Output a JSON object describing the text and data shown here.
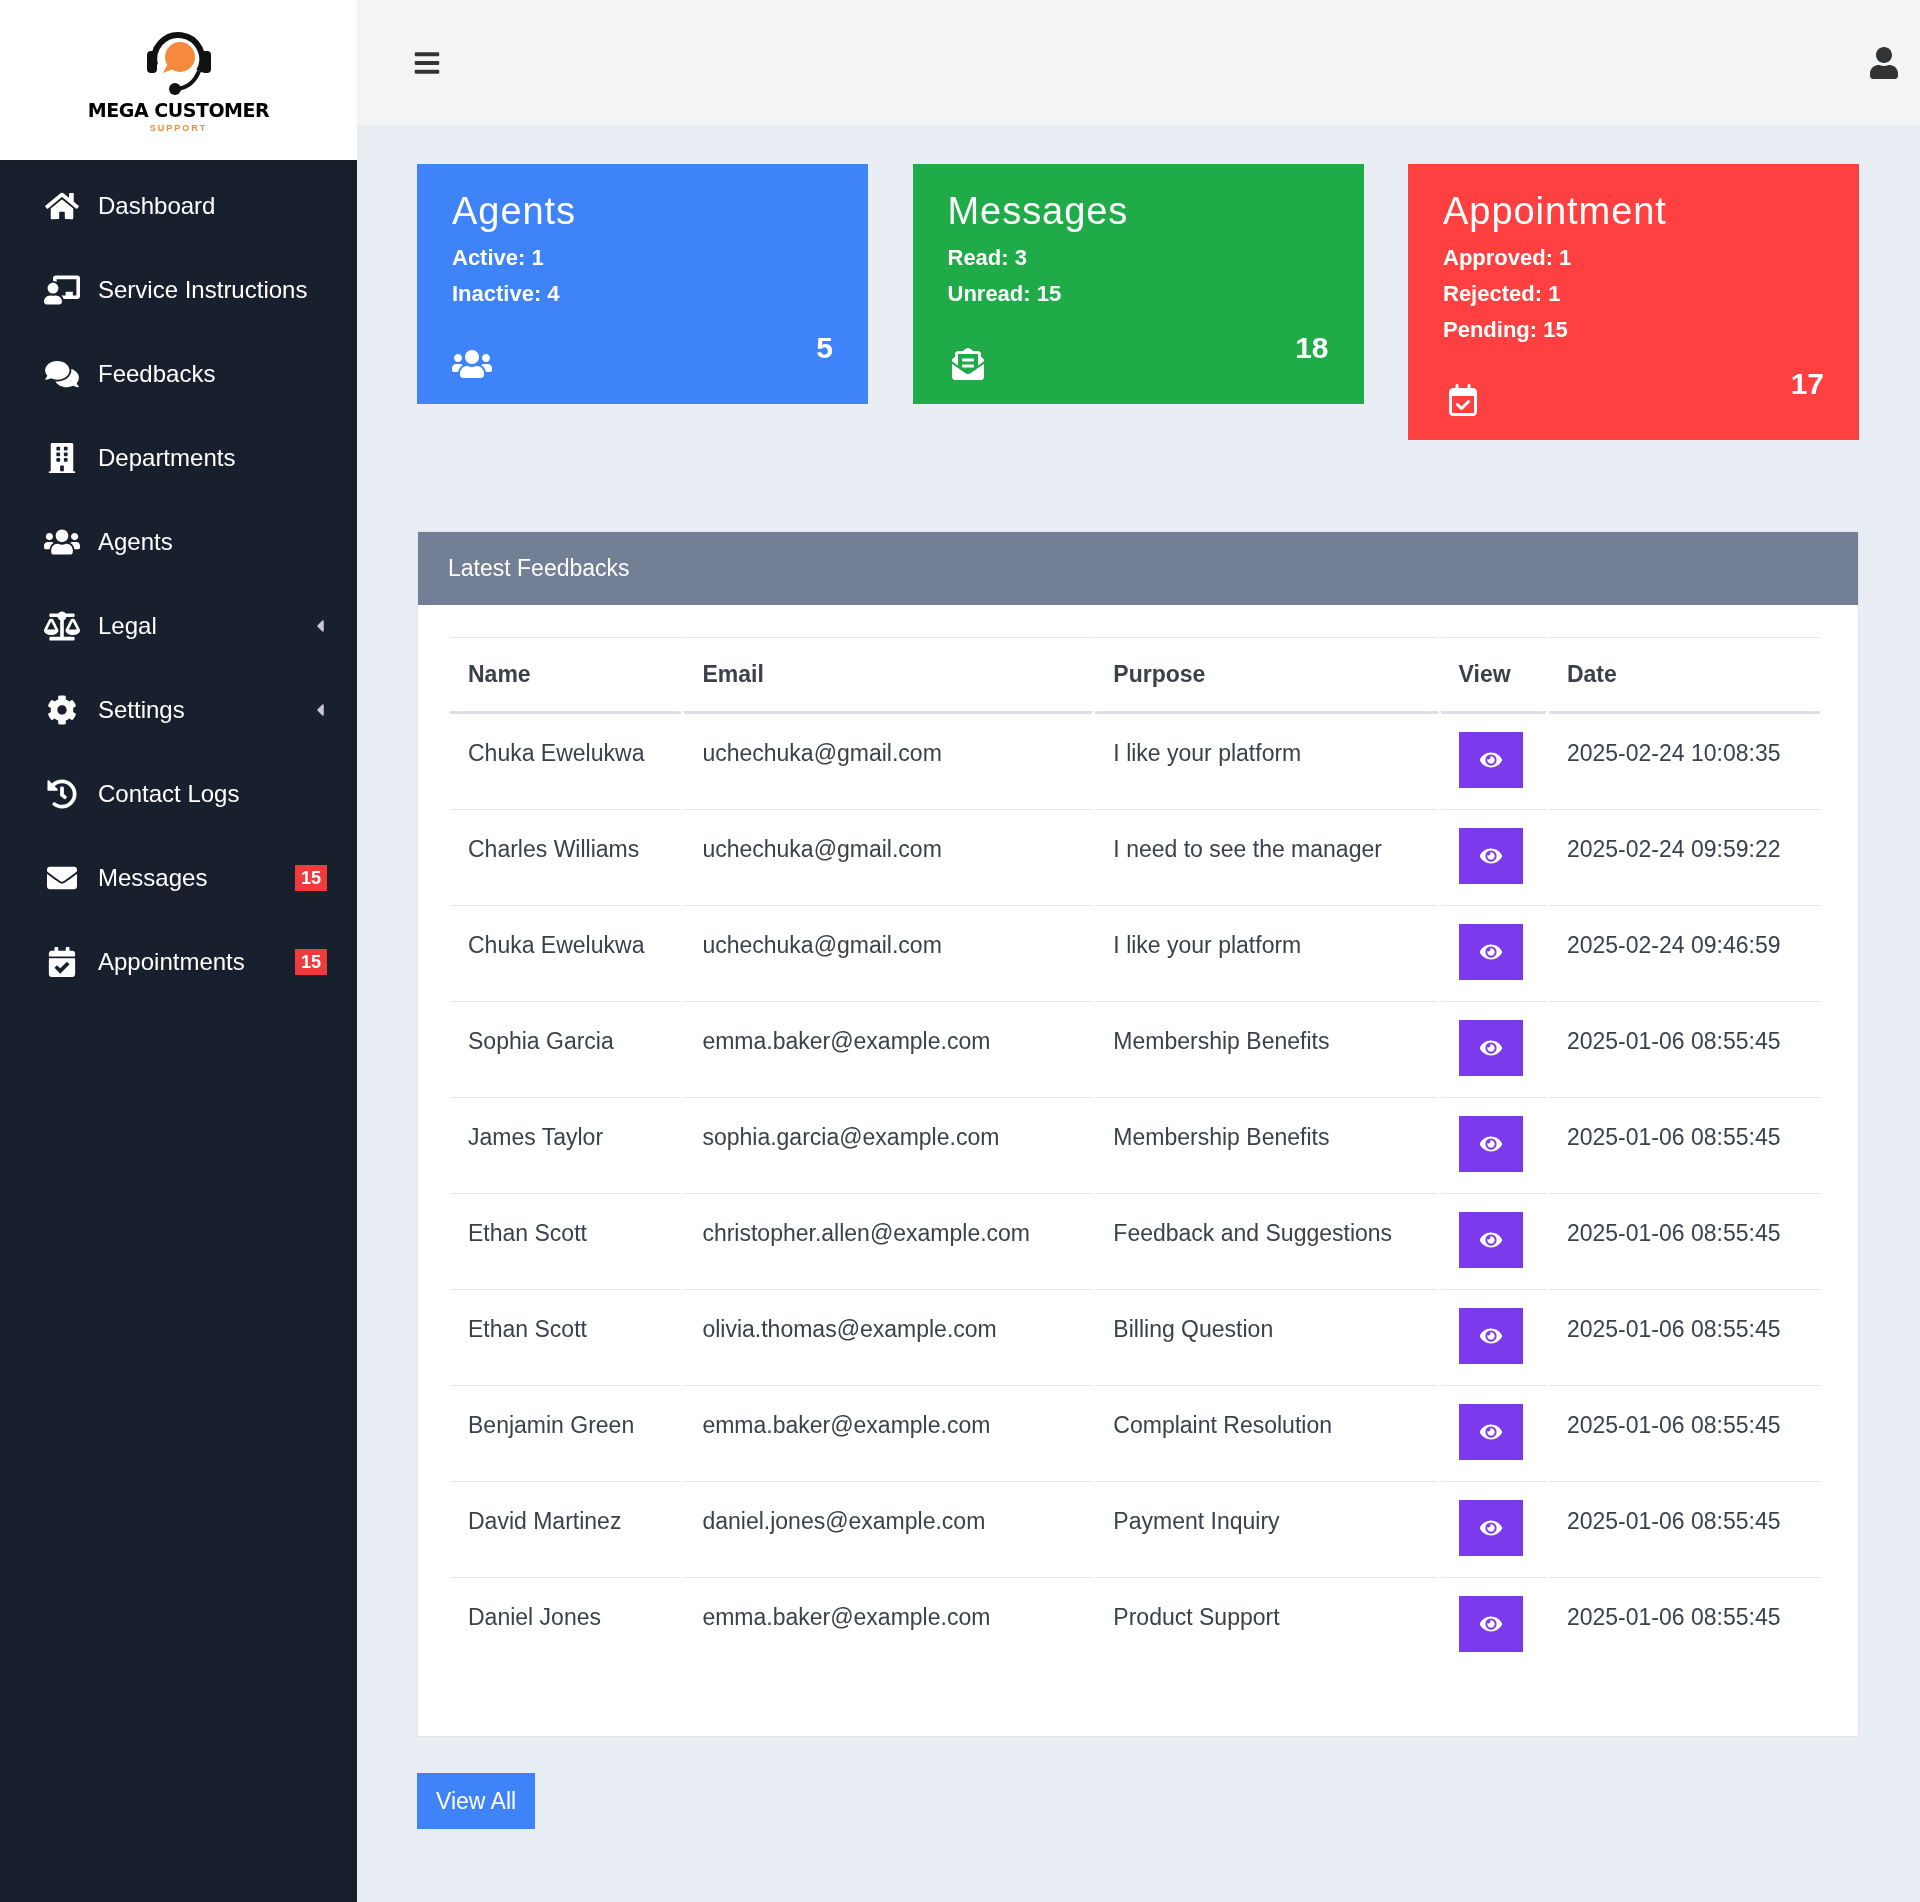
{
  "logo": {
    "title": "MEGA CUSTOMER",
    "subtitle": "SUPPORT"
  },
  "sidebar": {
    "items": [
      {
        "label": "Dashboard",
        "kind": "link"
      },
      {
        "label": "Service Instructions",
        "kind": "link"
      },
      {
        "label": "Feedbacks",
        "kind": "link"
      },
      {
        "label": "Departments",
        "kind": "link"
      },
      {
        "label": "Agents",
        "kind": "link"
      },
      {
        "label": "Legal",
        "kind": "submenu"
      },
      {
        "label": "Settings",
        "kind": "submenu"
      },
      {
        "label": "Contact Logs",
        "kind": "link"
      },
      {
        "label": "Messages",
        "kind": "link",
        "badge": "15"
      },
      {
        "label": "Appointments",
        "kind": "link",
        "badge": "15"
      }
    ]
  },
  "cards": [
    {
      "title": "Agents",
      "color": "#3f83f8",
      "lines": [
        "Active: 1",
        "Inactive: 4"
      ],
      "total": "5"
    },
    {
      "title": "Messages",
      "color": "#1fab48",
      "lines": [
        "Read: 3",
        "Unread: 15"
      ],
      "total": "18"
    },
    {
      "title": "Appointment",
      "color": "#ff4040",
      "lines": [
        "Approved: 1",
        "Rejected: 1",
        "Pending: 15"
      ],
      "total": "17"
    }
  ],
  "feedbacks": {
    "title": "Latest Feedbacks",
    "columns": [
      "Name",
      "Email",
      "Purpose",
      "View",
      "Date"
    ],
    "rows": [
      [
        "Chuka Ewelukwa",
        "uchechuka@gmail.com",
        "I like your platform",
        "2025-02-24 10:08:35"
      ],
      [
        "Charles Williams",
        "uchechuka@gmail.com",
        "I need to see the manager",
        "2025-02-24 09:59:22"
      ],
      [
        "Chuka Ewelukwa",
        "uchechuka@gmail.com",
        "I like your platform",
        "2025-02-24 09:46:59"
      ],
      [
        "Sophia Garcia",
        "emma.baker@example.com",
        "Membership Benefits",
        "2025-01-06 08:55:45"
      ],
      [
        "James Taylor",
        "sophia.garcia@example.com",
        "Membership Benefits",
        "2025-01-06 08:55:45"
      ],
      [
        "Ethan Scott",
        "christopher.allen@example.com",
        "Feedback and Suggestions",
        "2025-01-06 08:55:45"
      ],
      [
        "Ethan Scott",
        "olivia.thomas@example.com",
        "Billing Question",
        "2025-01-06 08:55:45"
      ],
      [
        "Benjamin Green",
        "emma.baker@example.com",
        "Complaint Resolution",
        "2025-01-06 08:55:45"
      ],
      [
        "David Martinez",
        "daniel.jones@example.com",
        "Payment Inquiry",
        "2025-01-06 08:55:45"
      ],
      [
        "Daniel Jones",
        "emma.baker@example.com",
        "Product Support",
        "2025-01-06 08:55:45"
      ]
    ],
    "button": "View All"
  }
}
